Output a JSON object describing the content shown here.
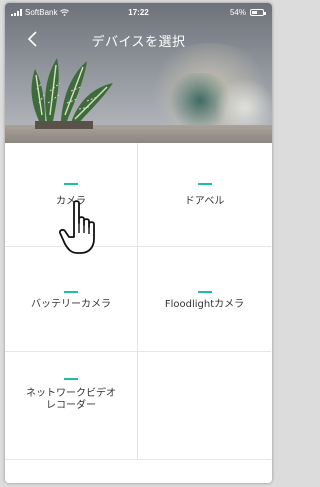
{
  "status_bar": {
    "carrier": "SoftBank",
    "time": "17:22",
    "battery": "54%",
    "battery_level": 0.54
  },
  "nav": {
    "title": "デバイスを選択",
    "back_icon": "chevron-left-icon"
  },
  "devices": [
    {
      "label": "カメラ"
    },
    {
      "label": "ドアベル"
    },
    {
      "label": "バッテリーカメラ"
    },
    {
      "label": "Floodlightカメラ"
    },
    {
      "label": "ネットワークビデオ\nレコーダー"
    }
  ],
  "colors": {
    "accent": "#1fbfa3",
    "text": "#333333",
    "divider": "#e6e6e6"
  }
}
